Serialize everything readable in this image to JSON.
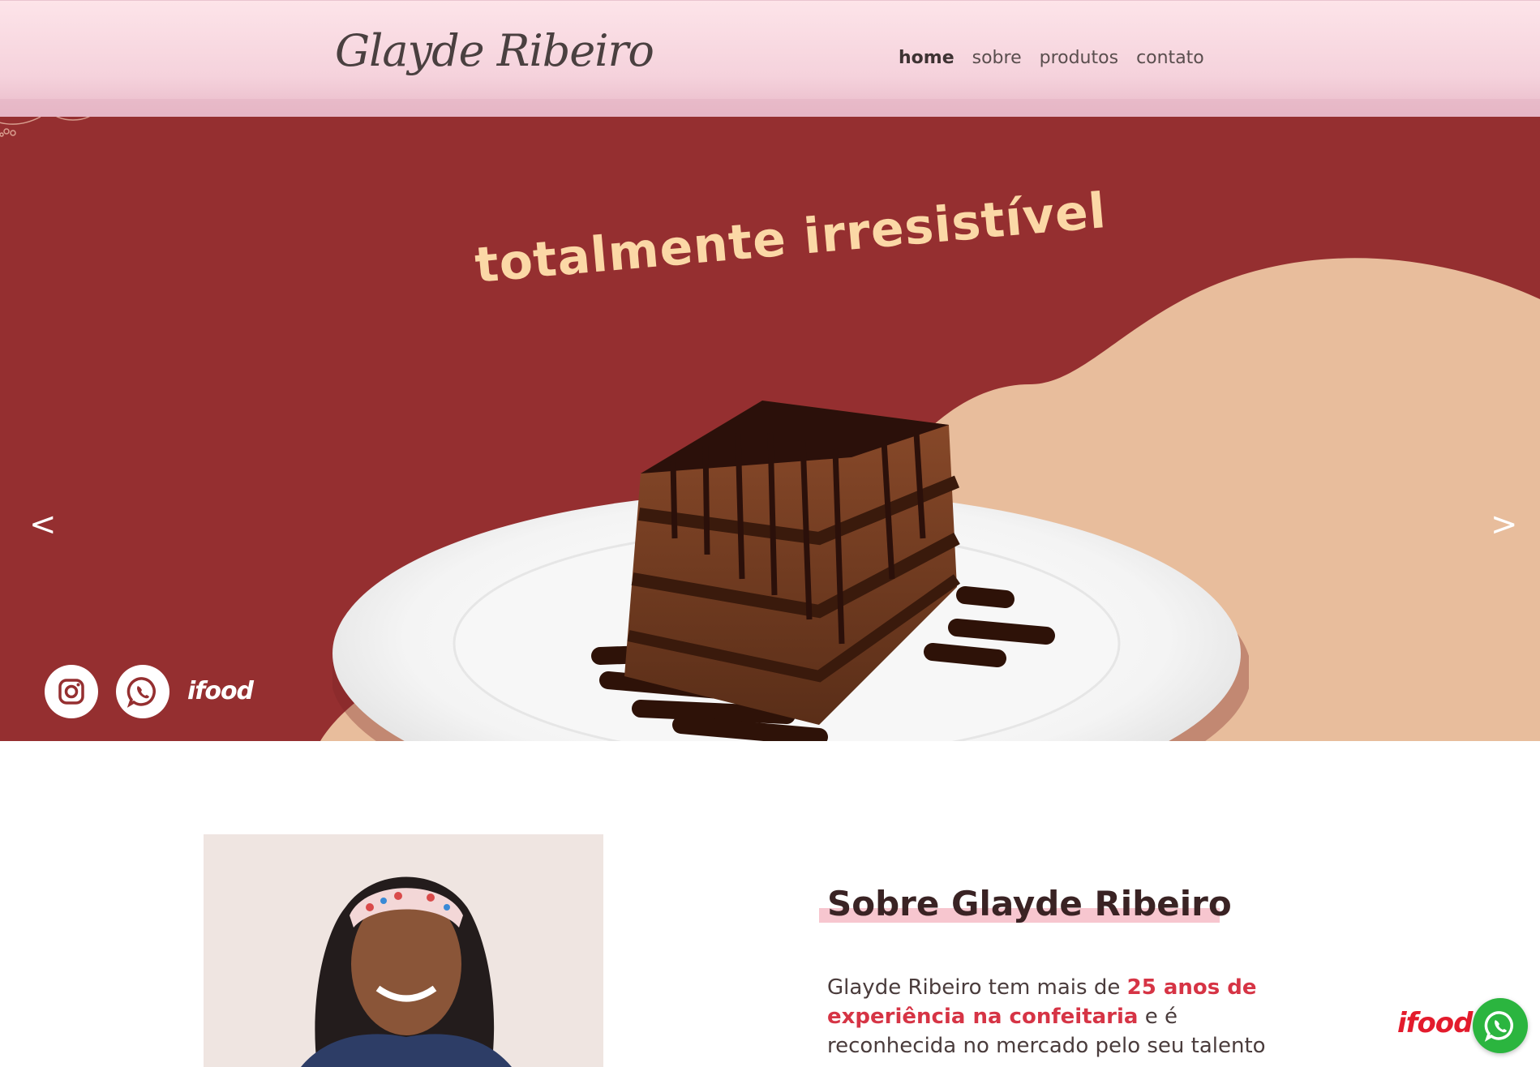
{
  "header": {
    "logo": "Glayde Ribeiro",
    "nav": [
      {
        "label": "home",
        "active": true
      },
      {
        "label": "sobre",
        "active": false
      },
      {
        "label": "produtos",
        "active": false
      },
      {
        "label": "contato",
        "active": false
      }
    ]
  },
  "hero": {
    "title": "totalmente irresistível",
    "prev_label": "<",
    "next_label": ">",
    "social": {
      "instagram_icon": "instagram-icon",
      "whatsapp_icon": "whatsapp-icon",
      "ifood_label": "ifood"
    },
    "colors": {
      "background": "#952f30",
      "blob": "#e8bd9c",
      "title": "#fbd8a6"
    }
  },
  "about": {
    "title": "Sobre Glayde Ribeiro",
    "text_start": "Glayde Ribeiro tem mais de ",
    "text_highlight": "25 anos de experiência na confeitaria",
    "text_end": " e é reconhecida no mercado pelo seu talento"
  },
  "floating": {
    "ifood_label": "ifood",
    "whatsapp_icon": "whatsapp-icon",
    "accent": "#2bb53f"
  }
}
